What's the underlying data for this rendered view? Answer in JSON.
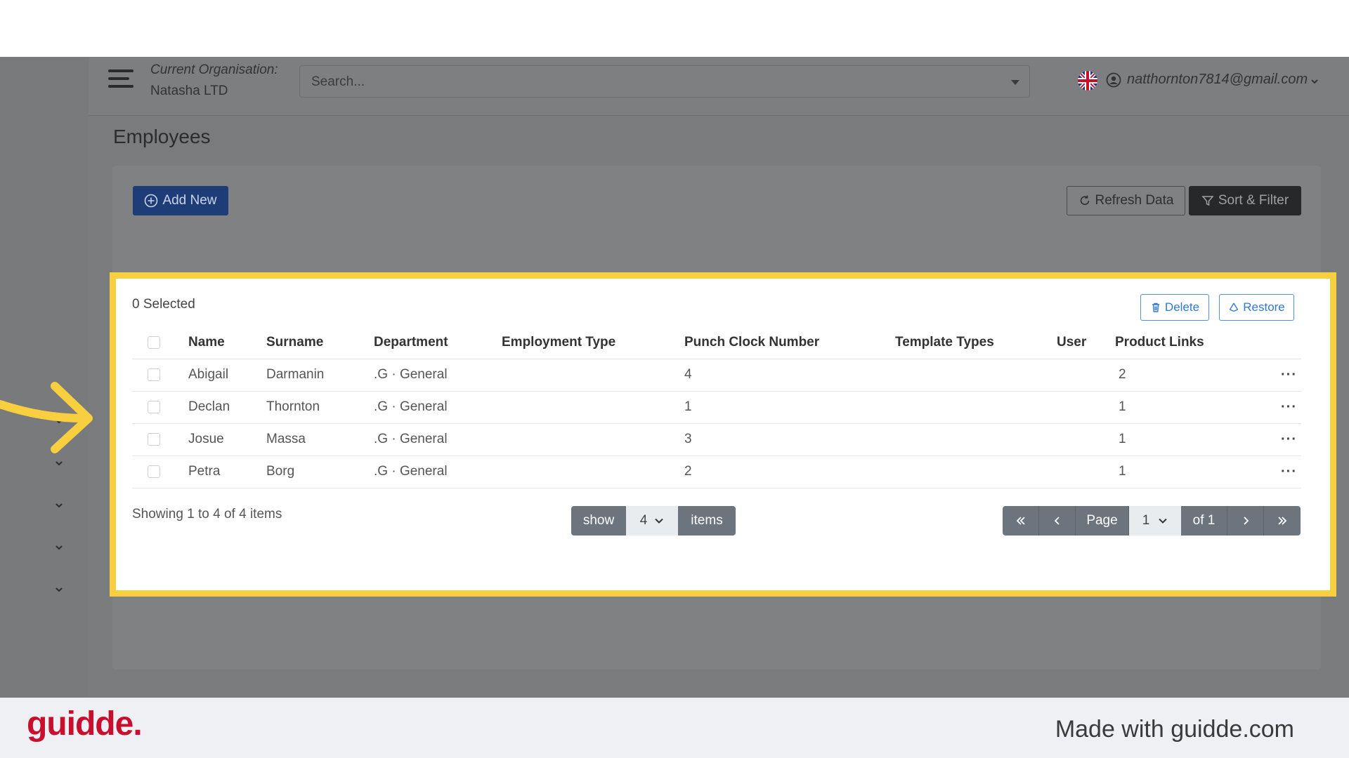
{
  "topbar": {
    "org_label": "Current Organisation:",
    "org_name": "Natasha LTD",
    "search_placeholder": "Search...",
    "user_email": "natthornton7814@gmail.com"
  },
  "page": {
    "title": "Employees",
    "add_new_label": "Add New",
    "refresh_label": "Refresh Data",
    "sort_filter_label": "Sort & Filter"
  },
  "panel": {
    "selected_count": "0 Selected",
    "delete_label": "Delete",
    "restore_label": "Restore"
  },
  "table": {
    "columns": [
      "Name",
      "Surname",
      "Department",
      "Employment Type",
      "Punch Clock Number",
      "Template Types",
      "User",
      "Product Links"
    ],
    "rows": [
      {
        "name": "Abigail",
        "surname": "Darmanin",
        "department": ".G · General",
        "employment_type": "",
        "punch_clock": "4",
        "template_types": "",
        "user": "",
        "product_links": "2"
      },
      {
        "name": "Declan",
        "surname": "Thornton",
        "department": ".G · General",
        "employment_type": "",
        "punch_clock": "1",
        "template_types": "",
        "user": "",
        "product_links": "1"
      },
      {
        "name": "Josue",
        "surname": "Massa",
        "department": ".G · General",
        "employment_type": "",
        "punch_clock": "3",
        "template_types": "",
        "user": "",
        "product_links": "1"
      },
      {
        "name": "Petra",
        "surname": "Borg",
        "department": ".G · General",
        "employment_type": "",
        "punch_clock": "2",
        "template_types": "",
        "user": "",
        "product_links": "1"
      }
    ],
    "row_menu_label": "···"
  },
  "pagination": {
    "showing_text": "Showing 1 to 4 of 4 items",
    "show_label": "show",
    "page_size": "4",
    "items_label": "items",
    "page_label": "Page",
    "current_page": "1",
    "of_label": "of 1"
  },
  "footer": {
    "brand": "guidde.",
    "made_with": "Made with guidde.com"
  },
  "colors": {
    "highlight": "#f8cf3e",
    "primary_dark": "#1e3d78",
    "link_blue": "#2f7ad8",
    "brand_red": "#c8102e",
    "dim_overlay": "#7a7b7c"
  },
  "icons": [
    "hamburger-icon",
    "flag-uk-icon",
    "user-circle-icon",
    "chevron-down-icon",
    "plus-circle-icon",
    "refresh-icon",
    "filter-icon",
    "trash-icon",
    "recycle-icon",
    "double-chevron-left-icon",
    "chevron-left-icon",
    "chevron-right-icon",
    "double-chevron-right-icon",
    "arrow-callout-icon"
  ]
}
